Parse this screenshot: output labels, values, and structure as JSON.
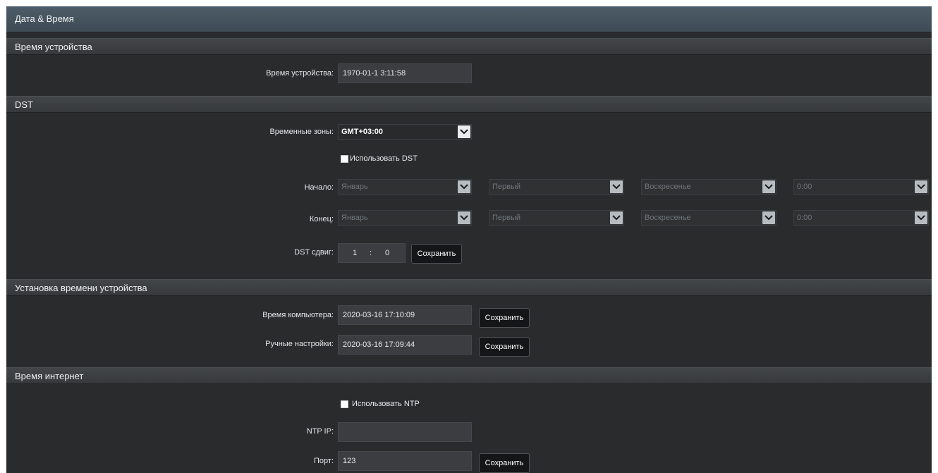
{
  "window": {
    "title": "Дата & Время"
  },
  "sections": {
    "device_time": {
      "header": "Время устройства",
      "label": "Время устройства:",
      "value": "1970-01-1 3:11:58"
    },
    "dst": {
      "header": "DST",
      "timezone_label": "Временные зоны:",
      "timezone_value": "GMT+03:00",
      "use_dst_label": "Использовать DST",
      "start_label": "Начало:",
      "end_label": "Конец:",
      "start": {
        "month": "Январь",
        "week": "Первый",
        "day": "Воскресенье",
        "time": "0:00"
      },
      "end": {
        "month": "Январь",
        "week": "Первый",
        "day": "Воскресенье",
        "time": "0:00"
      },
      "shift_label": "DST сдвиг:",
      "shift_hours": "1",
      "shift_sep": ":",
      "shift_minutes": "0",
      "save_label": "Сохранить"
    },
    "set_time": {
      "header": "Установка времени устройства",
      "computer_label": "Время компьютера:",
      "computer_value": "2020-03-16 17:10:09",
      "manual_label": "Ручные настройки:",
      "manual_value": "2020-03-16 17:09:44",
      "save_label": "Сохранить"
    },
    "internet_time": {
      "header": "Время интернет",
      "use_ntp_label": "Использовать NTP",
      "ntp_ip_label": "NTP IP:",
      "ntp_ip_value": "",
      "port_label": "Порт:",
      "port_value": "123",
      "save_label": "Сохранить"
    }
  },
  "icons": {
    "dropdown": "chevron-down-icon",
    "checkbox": "checkbox-icon"
  },
  "colors": {
    "title_bar": "#4d5d69",
    "background": "#2a2b2d",
    "button": "#151617"
  }
}
